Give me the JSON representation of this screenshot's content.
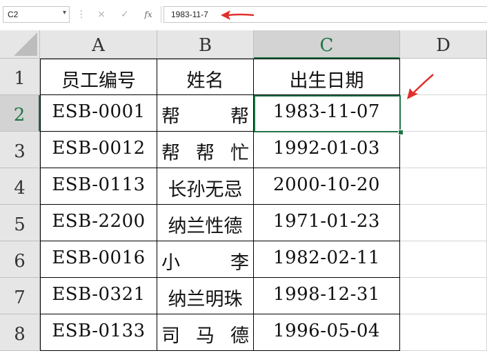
{
  "formula_bar": {
    "name_box": "C2",
    "formula_value": "1983-11-7",
    "cancel_icon": "×",
    "enter_icon": "✓",
    "fx_icon": "fx"
  },
  "columns": [
    "A",
    "B",
    "C",
    "D"
  ],
  "rows": [
    "1",
    "2",
    "3",
    "4",
    "5",
    "6",
    "7",
    "8"
  ],
  "header": {
    "id": "员工编号",
    "name": "姓名",
    "birth": "出生日期"
  },
  "records": [
    {
      "id": "ESB-0001",
      "name": "帮帮",
      "birth": "1983-11-07"
    },
    {
      "id": "ESB-0012",
      "name": "帮帮忙",
      "birth": "1992-01-03"
    },
    {
      "id": "ESB-0113",
      "name": "长孙无忌",
      "birth": "2000-10-20"
    },
    {
      "id": "ESB-2200",
      "name": "纳兰性德",
      "birth": "1971-01-23"
    },
    {
      "id": "ESB-0016",
      "name": "小李",
      "birth": "1982-02-11"
    },
    {
      "id": "ESB-0321",
      "name": "纳兰明珠",
      "birth": "1998-12-31"
    },
    {
      "id": "ESB-0133",
      "name": "司马德",
      "birth": "1996-05-04"
    }
  ],
  "selected_cell": "C2",
  "colors": {
    "accent": "#217346",
    "arrow": "#e0302a",
    "header_bg": "#e6e6e6"
  }
}
